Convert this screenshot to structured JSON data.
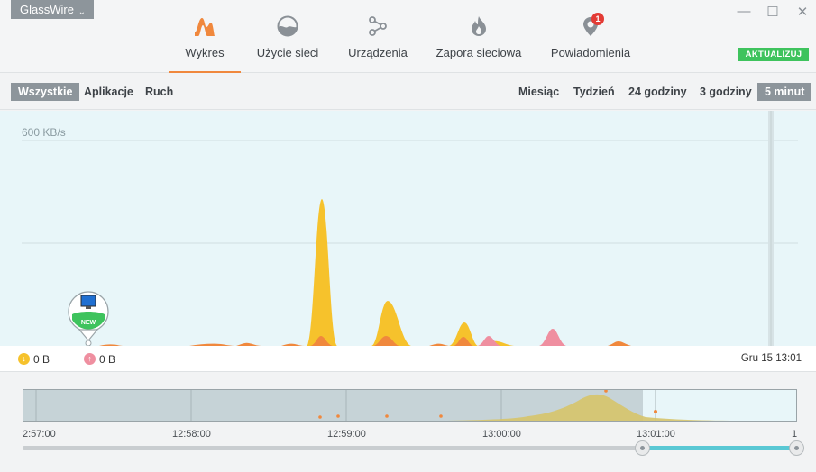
{
  "app": {
    "brand": "GlassWire"
  },
  "nav": [
    {
      "label": "Wykres",
      "icon": "graph-icon",
      "active": true
    },
    {
      "label": "Użycie sieci",
      "icon": "usage-icon"
    },
    {
      "label": "Urządzenia",
      "icon": "devices-icon"
    },
    {
      "label": "Zapora sieciowa",
      "icon": "firewall-icon"
    },
    {
      "label": "Powiadomienia",
      "icon": "alerts-icon",
      "badge": "1"
    }
  ],
  "update_label": "AKTUALIZUJ",
  "filters": {
    "left": [
      "Wszystkie",
      "Aplikacje",
      "Ruch"
    ],
    "left_selected": "Wszystkie",
    "right": [
      "Miesiąc",
      "Tydzień",
      "24 godziny",
      "3 godziny",
      "5 minut"
    ],
    "right_selected": "5 minut"
  },
  "graph": {
    "y_label": "600 KB/s",
    "marker_label": "NEW"
  },
  "legend": {
    "download_value": "0 B",
    "upload_value": "0 B",
    "date": "Gru 15 13:01"
  },
  "timeline": {
    "ticks": [
      "2:57:00",
      "12:58:00",
      "12:59:00",
      "13:00:00",
      "13:01:00",
      "1"
    ]
  },
  "colors": {
    "accent": "#f0883d",
    "download": "#f6c22c",
    "upload": "#f0883d",
    "update": "#3ec35d",
    "graph_bg": "#e8f6f9"
  }
}
